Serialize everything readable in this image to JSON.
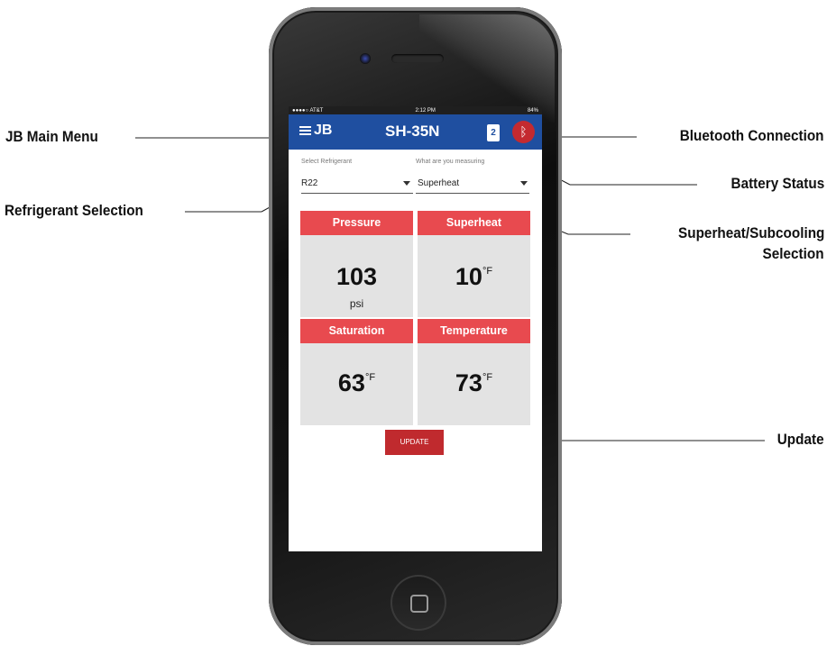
{
  "callouts": {
    "main_menu": "JB Main Menu",
    "refrigerant_selection": "Refrigerant Selection",
    "bluetooth_connection": "Bluetooth Connection",
    "battery_status": "Battery Status",
    "superheat_subcooling_line1": "Superheat/Subcooling",
    "superheat_subcooling_line2": "Selection",
    "update": "Update"
  },
  "status_bar": {
    "carrier": "●●●●○ AT&T",
    "time": "2:12 PM",
    "battery": "84%"
  },
  "app_bar": {
    "brand": "JB",
    "model": "SH-35N",
    "battery_level": "2"
  },
  "refrigerant": {
    "label": "Select Refrigerant",
    "value": "R22"
  },
  "measuring": {
    "label": "What are you measuring",
    "value": "Superheat"
  },
  "cards": {
    "pressure": {
      "title": "Pressure",
      "value": "103",
      "unit": "psi"
    },
    "superheat": {
      "title": "Superheat",
      "value": "10",
      "unit": "°F"
    },
    "saturation": {
      "title": "Saturation",
      "value": "63",
      "unit": "°F"
    },
    "temperature": {
      "title": "Temperature",
      "value": "73",
      "unit": "°F"
    }
  },
  "update_label": "UPDATE"
}
